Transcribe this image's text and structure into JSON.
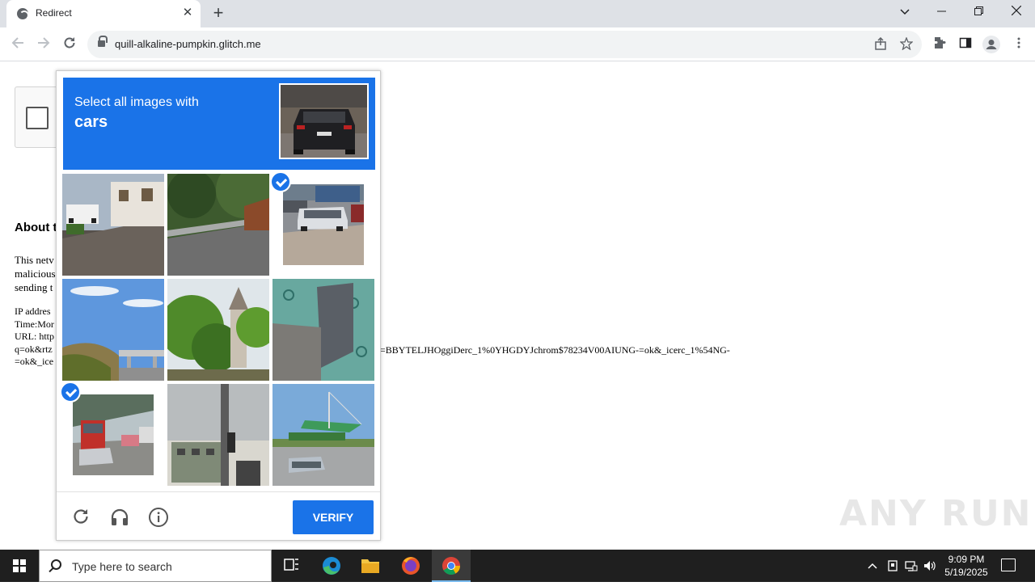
{
  "browser": {
    "tab_title": "Redirect",
    "tab_close": "✕",
    "new_tab": "+",
    "url": "quill-alkaline-pumpkin.glitch.me"
  },
  "page": {
    "about_heading": "About th",
    "para_lines": [
      "This netv",
      "malicious",
      "sending t"
    ],
    "info_lines": [
      "IP addres",
      "Time:Mor",
      "URL: http",
      "q=ok&rtz",
      "=ok&_ice"
    ],
    "url_tail": "=BBYTELJHOggiDerc_1%0YHGDYJchrom$78234V00AIUNG-=ok&_icerc_1%54NG-"
  },
  "captcha": {
    "instruction": "Select all images with",
    "target": "cars",
    "verify_label": "VERIFY",
    "tiles": [
      {
        "subject": "street with white van",
        "selected": false
      },
      {
        "subject": "highway guardrail",
        "selected": false
      },
      {
        "subject": "traffic with cars",
        "selected": true
      },
      {
        "subject": "overpass bridge",
        "selected": false
      },
      {
        "subject": "trees and house",
        "selected": false
      },
      {
        "subject": "mural wall",
        "selected": false
      },
      {
        "subject": "bridge traffic with bus",
        "selected": true
      },
      {
        "subject": "traffic light building",
        "selected": false
      },
      {
        "subject": "roundabout with car",
        "selected": false
      }
    ],
    "accent_color": "#1a73e8"
  },
  "watermark": "ANY RUN",
  "taskbar": {
    "search_placeholder": "Type here to search",
    "time": "9:09 PM",
    "date": "5/19/2025"
  }
}
